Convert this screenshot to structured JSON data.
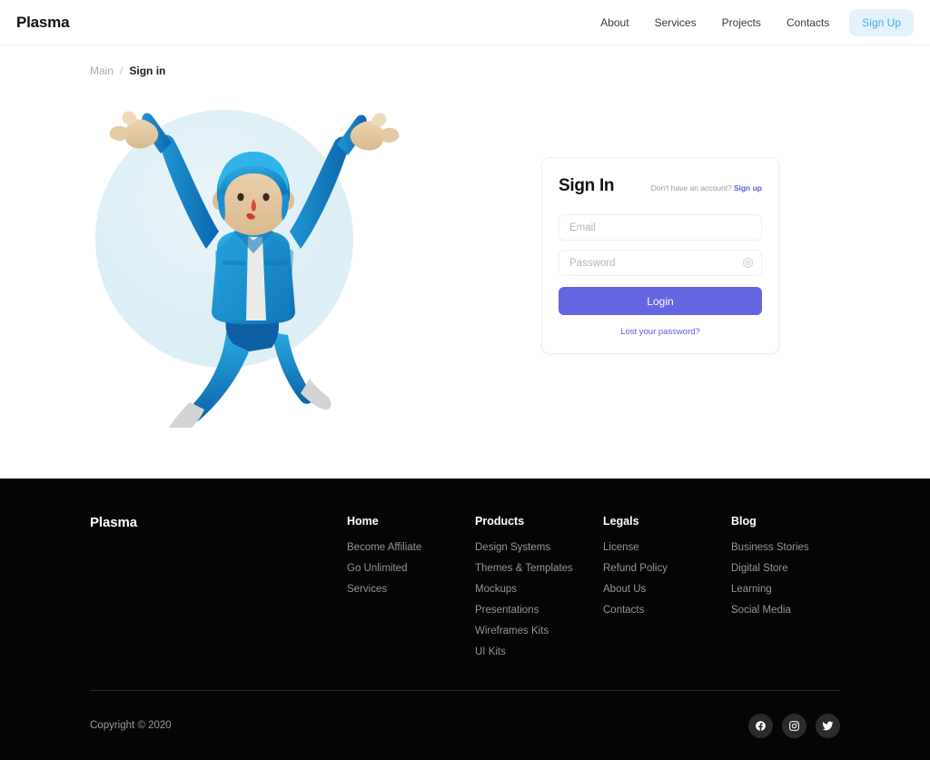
{
  "header": {
    "brand": "Plasma",
    "nav": [
      {
        "label": "About"
      },
      {
        "label": "Services"
      },
      {
        "label": "Projects"
      },
      {
        "label": "Contacts"
      }
    ],
    "signup_button": "Sign Up",
    "signup_bg": "#e3f2fb",
    "signup_color": "#45b0e3"
  },
  "breadcrumb": {
    "main": "Main",
    "separator": "/",
    "current": "Sign in"
  },
  "illustration": {
    "name": "jumping-person-thumbs-up-3d-illustration",
    "circle_color": "#e4f1f7",
    "suit_color": "#1e9ad6",
    "suit_dark": "#0f6fb5",
    "hair_color": "#1e9ad6",
    "skin_color": "#e0c09a",
    "shoe_color": "#d6d6d6",
    "shirt_color": "#eeeeee"
  },
  "signin": {
    "title": "Sign In",
    "subtitle": "Don't have an account?",
    "signup_link": "Sign up",
    "email_placeholder": "Email",
    "email_value": "",
    "password_placeholder": "Password",
    "password_value": "",
    "eye_icon": "eye-icon",
    "login_button": "Login",
    "login_color": "#6366e0",
    "lost_password": "Lost your password?",
    "link_color": "#5b5be0"
  },
  "footer": {
    "brand": "Plasma",
    "columns": [
      {
        "title": "Home",
        "links": [
          "Become Affiliate",
          "Go Unlimited",
          "Services"
        ]
      },
      {
        "title": "Products",
        "links": [
          "Design Systems",
          "Themes & Templates",
          "Mockups",
          "Presentations",
          "Wireframes Kits",
          "UI Kits"
        ]
      },
      {
        "title": "Legals",
        "links": [
          "License",
          "Refund Policy",
          "About Us",
          "Contacts"
        ]
      },
      {
        "title": "Blog",
        "links": [
          "Business Stories",
          "Digital Store",
          "Learning",
          "Social Media"
        ]
      }
    ],
    "copyright": "Copyright © 2020",
    "socials": [
      {
        "name": "facebook-icon"
      },
      {
        "name": "instagram-icon"
      },
      {
        "name": "twitter-icon"
      }
    ],
    "background": "#050505"
  }
}
